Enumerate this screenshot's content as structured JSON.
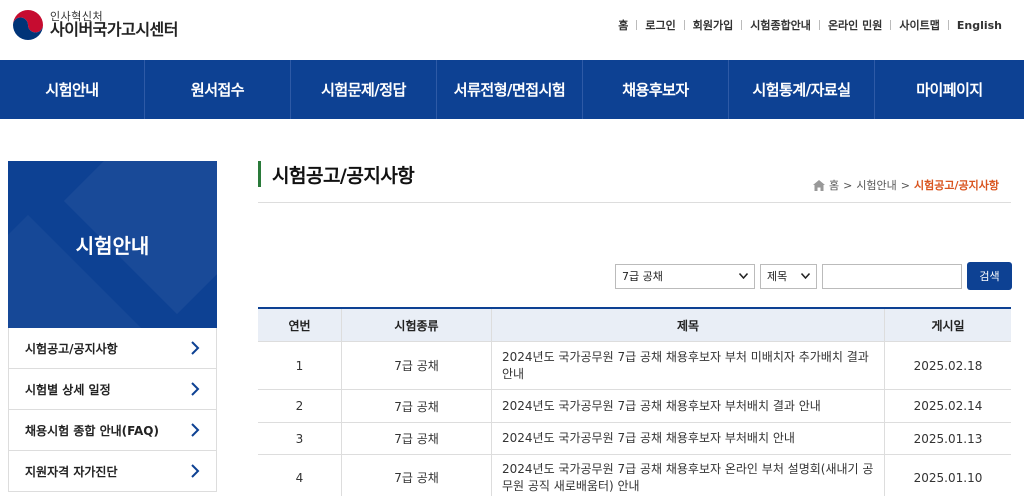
{
  "header": {
    "org": "인사혁신처",
    "site_name": "사이버국가고시센터",
    "util_links": [
      "홈",
      "로그인",
      "회원가입",
      "시험종합안내",
      "온라인 민원",
      "사이트맵",
      "English"
    ]
  },
  "gnb": {
    "items": [
      "시험안내",
      "원서접수",
      "시험문제/정답",
      "서류전형/면접시험",
      "채용후보자",
      "시험통계/자료실",
      "마이페이지"
    ]
  },
  "sidebar": {
    "title": "시험안내",
    "items": [
      "시험공고/공지사항",
      "시험별 상세 일정",
      "채용시험 종합 안내(FAQ)",
      "지원자격 자가진단"
    ]
  },
  "content": {
    "title": "시험공고/공지사항",
    "breadcrumb": {
      "home": "홈",
      "sep1": ">",
      "level1": "시험안내",
      "sep2": ">",
      "current": "시험공고/공지사항"
    }
  },
  "search": {
    "type_selected": "7급 공채",
    "field_selected": "제목",
    "query": "",
    "button_label": "검색"
  },
  "table": {
    "headers": [
      "연번",
      "시험종류",
      "제목",
      "게시일"
    ],
    "rows": [
      {
        "no": "1",
        "type": "7급 공채",
        "title": "2024년도 국가공무원 7급 공채 채용후보자 부처 미배치자 추가배치 결과 안내",
        "date": "2025.02.18"
      },
      {
        "no": "2",
        "type": "7급 공채",
        "title": "2024년도 국가공무원 7급 공채 채용후보자 부처배치 결과 안내",
        "date": "2025.02.14"
      },
      {
        "no": "3",
        "type": "7급 공채",
        "title": "2024년도 국가공무원 7급 공채 채용후보자 부처배치 안내",
        "date": "2025.01.13"
      },
      {
        "no": "4",
        "type": "7급 공채",
        "title": "2024년도 국가공무원 7급 공채 채용후보자 온라인 부처 설명회(새내기 공무원 공직 새로배움터) 안내",
        "date": "2025.01.10"
      }
    ]
  },
  "colors": {
    "brand_blue": "#0d4193",
    "accent_orange": "#d9541e",
    "title_mark_green": "#2a7a3a",
    "table_head_bg": "#e9eef6"
  }
}
